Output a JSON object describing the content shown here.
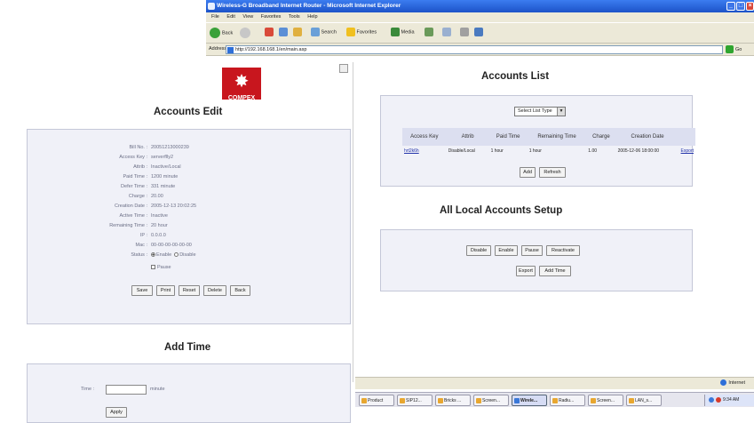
{
  "browser": {
    "title": "Wireless-G Broadband Internet Router - Microsoft Internet Explorer",
    "menu": [
      "File",
      "Edit",
      "View",
      "Favorites",
      "Tools",
      "Help"
    ],
    "toolbar": {
      "back": "Back",
      "search": "Search",
      "favorites": "Favorites",
      "media": "Media"
    },
    "address_label": "Address",
    "address_url": "http://192.168.168.1/en/main.asp",
    "go_label": "Go",
    "status_zone": "Internet"
  },
  "logo": {
    "text": "COMPEX"
  },
  "accounts_list": {
    "title": "Accounts List",
    "select_value": "Select List Type",
    "columns": [
      "Access Key",
      "Attrib",
      "Paid Time",
      "Remaining Time",
      "Charge",
      "Creation Date",
      ""
    ],
    "rows": [
      {
        "access_key": "hrt2k6h",
        "attrib": "Disable/Local",
        "paid_time": "1 hour",
        "remaining_time": "1 hour",
        "charge": "1.00",
        "creation_date": "2005-12-06 18:00:00",
        "action": "Export"
      }
    ],
    "add_label": "Add",
    "refresh_label": "Refresh"
  },
  "local_setup": {
    "title": "All Local Accounts Setup",
    "disable_label": "Disable",
    "enable_label": "Enable",
    "pause_label": "Pause",
    "reactivate_label": "Reactivate",
    "export_label": "Export",
    "add_time_label": "Add Time"
  },
  "accounts_edit": {
    "title": "Accounts Edit",
    "fields": [
      {
        "label": "Bill No. :",
        "value": "20051213000239"
      },
      {
        "label": "Access Key :",
        "value": "serverflly2"
      },
      {
        "label": "Attrib :",
        "value": "Inactive/Local"
      },
      {
        "label": "Paid Time :",
        "value": "1200 minute"
      },
      {
        "label": "Defer Time :",
        "value": "331 minute"
      },
      {
        "label": "Charge :",
        "value": "20.00"
      },
      {
        "label": "Creation Date :",
        "value": "2005-12-13 20:02:25"
      },
      {
        "label": "Active Time :",
        "value": "Inactive"
      },
      {
        "label": "Remaining Time :",
        "value": "20 hour"
      },
      {
        "label": "IP :",
        "value": "0.0.0.0"
      },
      {
        "label": "Mac :",
        "value": "00-00-00-00-00-00"
      }
    ],
    "status_label": "Status :",
    "enable_option": "Enable",
    "disable_option": "Disable",
    "pause_option": "Pause",
    "buttons": {
      "save": "Save",
      "print": "Print",
      "reset": "Reset",
      "delete": "Delete",
      "back": "Back"
    }
  },
  "add_time": {
    "title": "Add Time",
    "time_label": "Time :",
    "unit_label": "minute",
    "apply_label": "Apply"
  },
  "taskbar": {
    "items": [
      "Product",
      "SIP12...",
      "Bricks ...",
      "Screen...",
      "Wirele...",
      "Radiu...",
      "Screen...",
      "LAN_s..."
    ],
    "clock": "9:34 AM"
  }
}
